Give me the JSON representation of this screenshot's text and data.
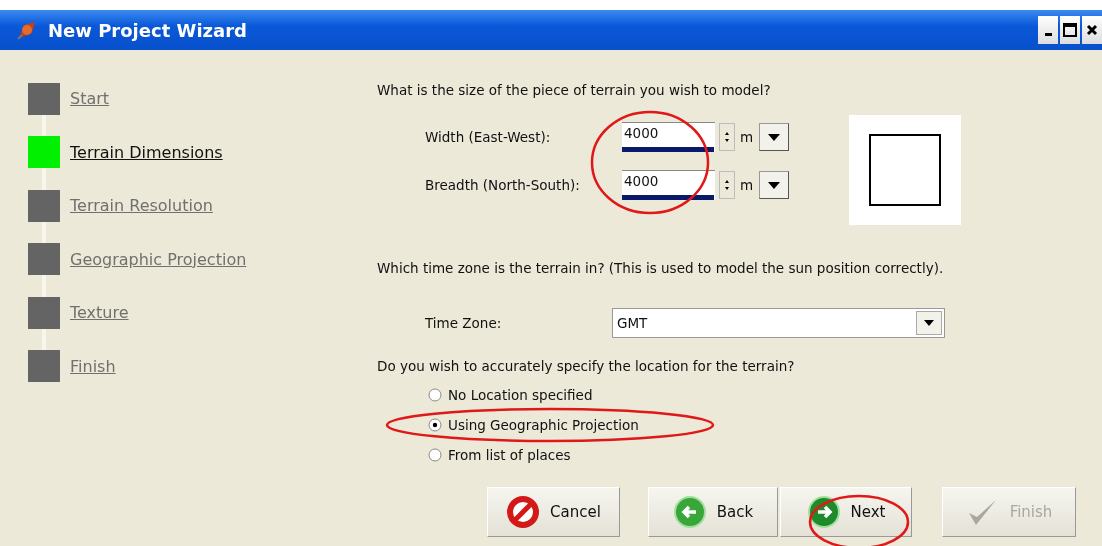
{
  "window": {
    "title": "New Project Wizard"
  },
  "steps": [
    {
      "label": "Start",
      "selected": false
    },
    {
      "label": "Terrain Dimensions",
      "selected": true
    },
    {
      "label": "Terrain Resolution",
      "selected": false
    },
    {
      "label": "Geographic Projection",
      "selected": false
    },
    {
      "label": "Texture",
      "selected": false
    },
    {
      "label": "Finish",
      "selected": false
    }
  ],
  "dimensions": {
    "question": "What is the size of the piece of terrain you wish to model?",
    "circled": true,
    "fields": [
      {
        "label": "Width (East-West):",
        "value": "4000",
        "unit": "m"
      },
      {
        "label": "Breadth (North-South):",
        "value": "4000",
        "unit": "m"
      }
    ]
  },
  "time_zone": {
    "question": "Which time zone is the terrain in? (This is used to model the sun position correctly).",
    "label": "Time Zone:",
    "value": "GMT"
  },
  "location": {
    "question": "Do you wish to accurately specify the location for the terrain?",
    "options": [
      {
        "label": "No Location specified",
        "selected": false,
        "circled": false
      },
      {
        "label": "Using Geographic Projection",
        "selected": true,
        "circled": true
      },
      {
        "label": "From list of places",
        "selected": false,
        "circled": false
      }
    ]
  },
  "buttons": [
    {
      "kind": "cancel",
      "label": "Cancel",
      "disabled": false,
      "circled": false
    },
    {
      "kind": "back",
      "label": "Back",
      "disabled": false,
      "circled": false
    },
    {
      "kind": "next",
      "label": "Next",
      "disabled": false,
      "circled": true
    },
    {
      "kind": "finish",
      "label": "Finish",
      "disabled": true,
      "circled": false
    }
  ]
}
